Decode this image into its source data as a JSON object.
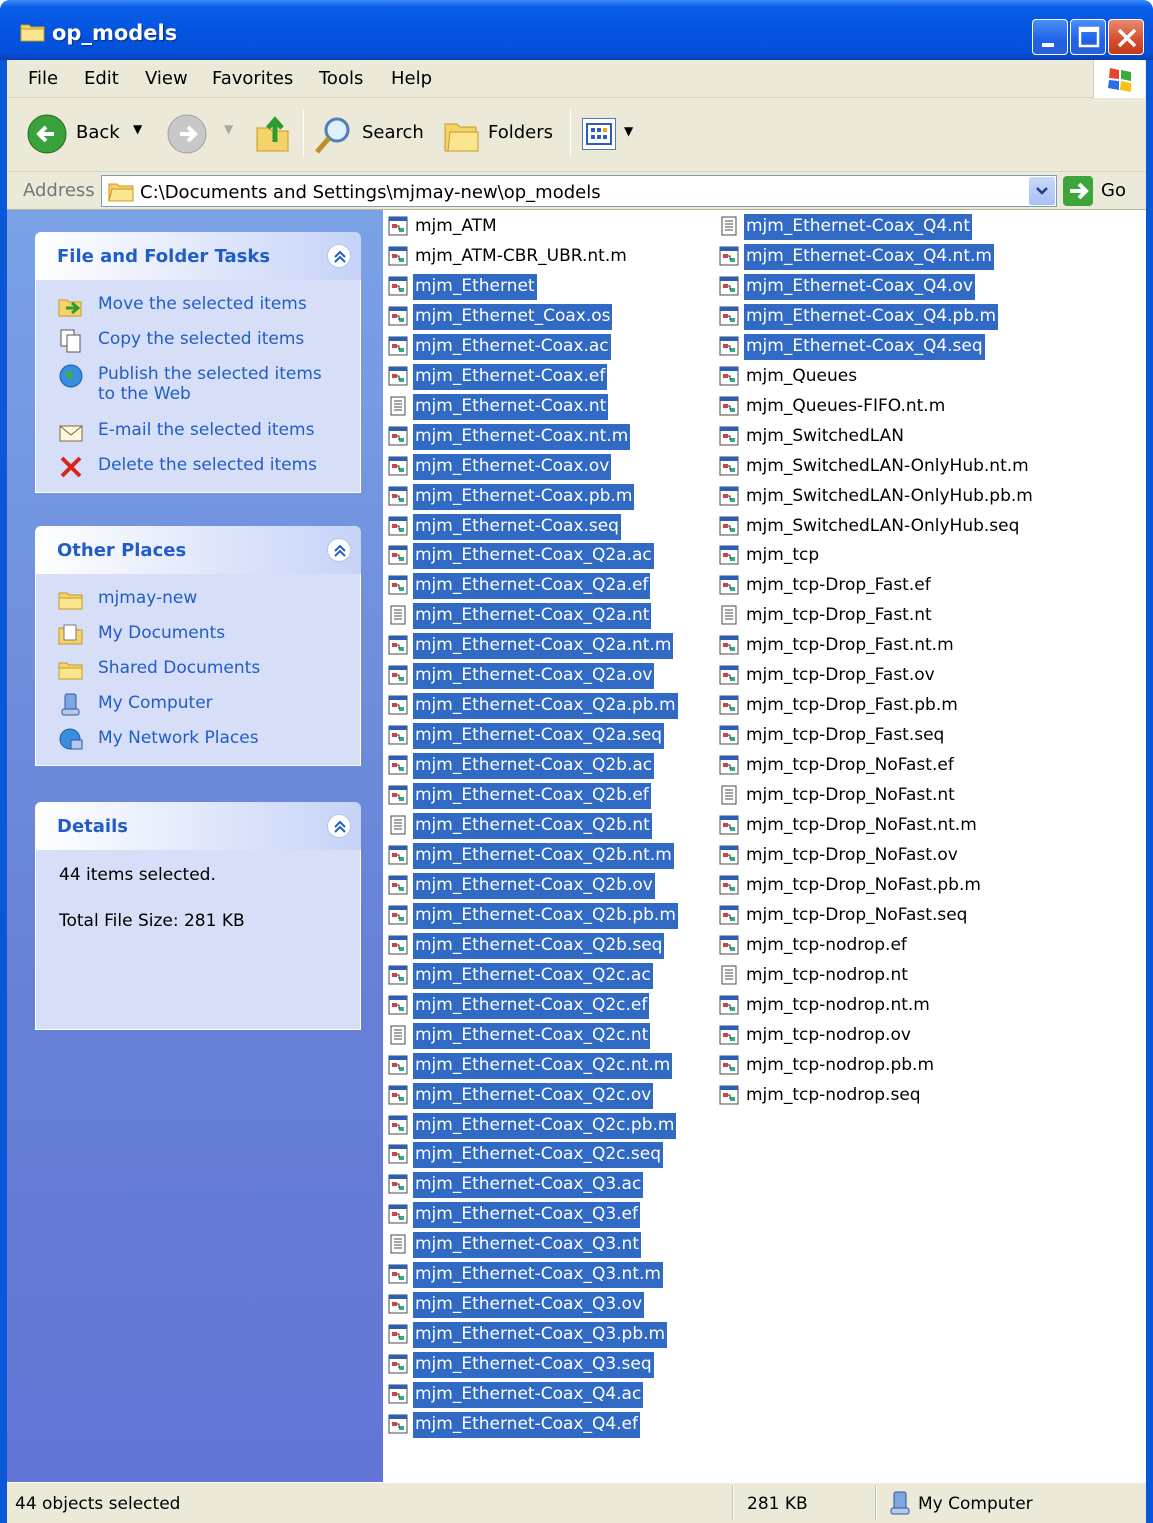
{
  "window": {
    "title": "op_models"
  },
  "menu": [
    "File",
    "Edit",
    "View",
    "Favorites",
    "Tools",
    "Help"
  ],
  "toolbar": {
    "back": "Back",
    "search": "Search",
    "folders": "Folders"
  },
  "address": {
    "label": "Address",
    "path": "C:\\Documents and Settings\\mjmay-new\\op_models",
    "go": "Go"
  },
  "tasks_panel": {
    "title": "File and Folder Tasks",
    "items": [
      {
        "label": "Move the selected items",
        "icon": "move-icon"
      },
      {
        "label": "Copy the selected items",
        "icon": "copy-icon"
      },
      {
        "label": "Publish the selected items to the Web",
        "icon": "globe-icon"
      },
      {
        "label": "E-mail the selected items",
        "icon": "envelope-icon"
      },
      {
        "label": "Delete the selected items",
        "icon": "delete-x-icon"
      }
    ]
  },
  "places_panel": {
    "title": "Other Places",
    "items": [
      {
        "label": "mjmay-new",
        "icon": "folder-icon"
      },
      {
        "label": "My Documents",
        "icon": "my-documents-icon"
      },
      {
        "label": "Shared Documents",
        "icon": "folder-icon"
      },
      {
        "label": "My Computer",
        "icon": "computer-icon"
      },
      {
        "label": "My Network Places",
        "icon": "network-icon"
      }
    ]
  },
  "details_panel": {
    "title": "Details",
    "line1": "44 items selected.",
    "line2": "Total File Size: 281 KB"
  },
  "files_col1": [
    {
      "name": "mjm_ATM",
      "sel": false,
      "type": "model"
    },
    {
      "name": "mjm_ATM-CBR_UBR.nt.m",
      "sel": false,
      "type": "model"
    },
    {
      "name": "mjm_Ethernet",
      "sel": true,
      "type": "model"
    },
    {
      "name": "mjm_Ethernet_Coax.os",
      "sel": true,
      "type": "model"
    },
    {
      "name": "mjm_Ethernet-Coax.ac",
      "sel": true,
      "type": "model"
    },
    {
      "name": "mjm_Ethernet-Coax.ef",
      "sel": true,
      "type": "model"
    },
    {
      "name": "mjm_Ethernet-Coax.nt",
      "sel": true,
      "type": "text"
    },
    {
      "name": "mjm_Ethernet-Coax.nt.m",
      "sel": true,
      "type": "model"
    },
    {
      "name": "mjm_Ethernet-Coax.ov",
      "sel": true,
      "type": "model"
    },
    {
      "name": "mjm_Ethernet-Coax.pb.m",
      "sel": true,
      "type": "model"
    },
    {
      "name": "mjm_Ethernet-Coax.seq",
      "sel": true,
      "type": "model"
    },
    {
      "name": "mjm_Ethernet-Coax_Q2a.ac",
      "sel": true,
      "type": "model"
    },
    {
      "name": "mjm_Ethernet-Coax_Q2a.ef",
      "sel": true,
      "type": "model"
    },
    {
      "name": "mjm_Ethernet-Coax_Q2a.nt",
      "sel": true,
      "type": "text"
    },
    {
      "name": "mjm_Ethernet-Coax_Q2a.nt.m",
      "sel": true,
      "type": "model"
    },
    {
      "name": "mjm_Ethernet-Coax_Q2a.ov",
      "sel": true,
      "type": "model"
    },
    {
      "name": "mjm_Ethernet-Coax_Q2a.pb.m",
      "sel": true,
      "type": "model"
    },
    {
      "name": "mjm_Ethernet-Coax_Q2a.seq",
      "sel": true,
      "type": "model"
    },
    {
      "name": "mjm_Ethernet-Coax_Q2b.ac",
      "sel": true,
      "type": "model"
    },
    {
      "name": "mjm_Ethernet-Coax_Q2b.ef",
      "sel": true,
      "type": "model"
    },
    {
      "name": "mjm_Ethernet-Coax_Q2b.nt",
      "sel": true,
      "type": "text"
    },
    {
      "name": "mjm_Ethernet-Coax_Q2b.nt.m",
      "sel": true,
      "type": "model"
    },
    {
      "name": "mjm_Ethernet-Coax_Q2b.ov",
      "sel": true,
      "type": "model"
    },
    {
      "name": "mjm_Ethernet-Coax_Q2b.pb.m",
      "sel": true,
      "type": "model"
    },
    {
      "name": "mjm_Ethernet-Coax_Q2b.seq",
      "sel": true,
      "type": "model"
    },
    {
      "name": "mjm_Ethernet-Coax_Q2c.ac",
      "sel": true,
      "type": "model"
    },
    {
      "name": "mjm_Ethernet-Coax_Q2c.ef",
      "sel": true,
      "type": "model"
    },
    {
      "name": "mjm_Ethernet-Coax_Q2c.nt",
      "sel": true,
      "type": "text"
    },
    {
      "name": "mjm_Ethernet-Coax_Q2c.nt.m",
      "sel": true,
      "type": "model"
    },
    {
      "name": "mjm_Ethernet-Coax_Q2c.ov",
      "sel": true,
      "type": "model"
    },
    {
      "name": "mjm_Ethernet-Coax_Q2c.pb.m",
      "sel": true,
      "type": "model"
    },
    {
      "name": "mjm_Ethernet-Coax_Q2c.seq",
      "sel": true,
      "type": "model"
    },
    {
      "name": "mjm_Ethernet-Coax_Q3.ac",
      "sel": true,
      "type": "model"
    },
    {
      "name": "mjm_Ethernet-Coax_Q3.ef",
      "sel": true,
      "type": "model"
    },
    {
      "name": "mjm_Ethernet-Coax_Q3.nt",
      "sel": true,
      "type": "text"
    },
    {
      "name": "mjm_Ethernet-Coax_Q3.nt.m",
      "sel": true,
      "type": "model"
    },
    {
      "name": "mjm_Ethernet-Coax_Q3.ov",
      "sel": true,
      "type": "model"
    },
    {
      "name": "mjm_Ethernet-Coax_Q3.pb.m",
      "sel": true,
      "type": "model"
    },
    {
      "name": "mjm_Ethernet-Coax_Q3.seq",
      "sel": true,
      "type": "model"
    },
    {
      "name": "mjm_Ethernet-Coax_Q4.ac",
      "sel": true,
      "type": "model"
    },
    {
      "name": "mjm_Ethernet-Coax_Q4.ef",
      "sel": true,
      "type": "model"
    }
  ],
  "files_col2": [
    {
      "name": "mjm_Ethernet-Coax_Q4.nt",
      "sel": true,
      "type": "text"
    },
    {
      "name": "mjm_Ethernet-Coax_Q4.nt.m",
      "sel": true,
      "type": "model"
    },
    {
      "name": "mjm_Ethernet-Coax_Q4.ov",
      "sel": true,
      "type": "model"
    },
    {
      "name": "mjm_Ethernet-Coax_Q4.pb.m",
      "sel": true,
      "type": "model"
    },
    {
      "name": "mjm_Ethernet-Coax_Q4.seq",
      "sel": true,
      "type": "model"
    },
    {
      "name": "mjm_Queues",
      "sel": false,
      "type": "model"
    },
    {
      "name": "mjm_Queues-FIFO.nt.m",
      "sel": false,
      "type": "model"
    },
    {
      "name": "mjm_SwitchedLAN",
      "sel": false,
      "type": "model"
    },
    {
      "name": "mjm_SwitchedLAN-OnlyHub.nt.m",
      "sel": false,
      "type": "model"
    },
    {
      "name": "mjm_SwitchedLAN-OnlyHub.pb.m",
      "sel": false,
      "type": "model"
    },
    {
      "name": "mjm_SwitchedLAN-OnlyHub.seq",
      "sel": false,
      "type": "model"
    },
    {
      "name": "mjm_tcp",
      "sel": false,
      "type": "model"
    },
    {
      "name": "mjm_tcp-Drop_Fast.ef",
      "sel": false,
      "type": "model"
    },
    {
      "name": "mjm_tcp-Drop_Fast.nt",
      "sel": false,
      "type": "text"
    },
    {
      "name": "mjm_tcp-Drop_Fast.nt.m",
      "sel": false,
      "type": "model"
    },
    {
      "name": "mjm_tcp-Drop_Fast.ov",
      "sel": false,
      "type": "model"
    },
    {
      "name": "mjm_tcp-Drop_Fast.pb.m",
      "sel": false,
      "type": "model"
    },
    {
      "name": "mjm_tcp-Drop_Fast.seq",
      "sel": false,
      "type": "model"
    },
    {
      "name": "mjm_tcp-Drop_NoFast.ef",
      "sel": false,
      "type": "model"
    },
    {
      "name": "mjm_tcp-Drop_NoFast.nt",
      "sel": false,
      "type": "text"
    },
    {
      "name": "mjm_tcp-Drop_NoFast.nt.m",
      "sel": false,
      "type": "model"
    },
    {
      "name": "mjm_tcp-Drop_NoFast.ov",
      "sel": false,
      "type": "model"
    },
    {
      "name": "mjm_tcp-Drop_NoFast.pb.m",
      "sel": false,
      "type": "model"
    },
    {
      "name": "mjm_tcp-Drop_NoFast.seq",
      "sel": false,
      "type": "model"
    },
    {
      "name": "mjm_tcp-nodrop.ef",
      "sel": false,
      "type": "model"
    },
    {
      "name": "mjm_tcp-nodrop.nt",
      "sel": false,
      "type": "text"
    },
    {
      "name": "mjm_tcp-nodrop.nt.m",
      "sel": false,
      "type": "model"
    },
    {
      "name": "mjm_tcp-nodrop.ov",
      "sel": false,
      "type": "model"
    },
    {
      "name": "mjm_tcp-nodrop.pb.m",
      "sel": false,
      "type": "model"
    },
    {
      "name": "mjm_tcp-nodrop.seq",
      "sel": false,
      "type": "model"
    }
  ],
  "status": {
    "selected": "44 objects selected",
    "size": "281 KB",
    "zone": "My Computer"
  },
  "colors": {
    "selection": "#316ac5",
    "titlebar": "#0454e0",
    "taskpane": "#6781d6",
    "link": "#215dc6"
  }
}
